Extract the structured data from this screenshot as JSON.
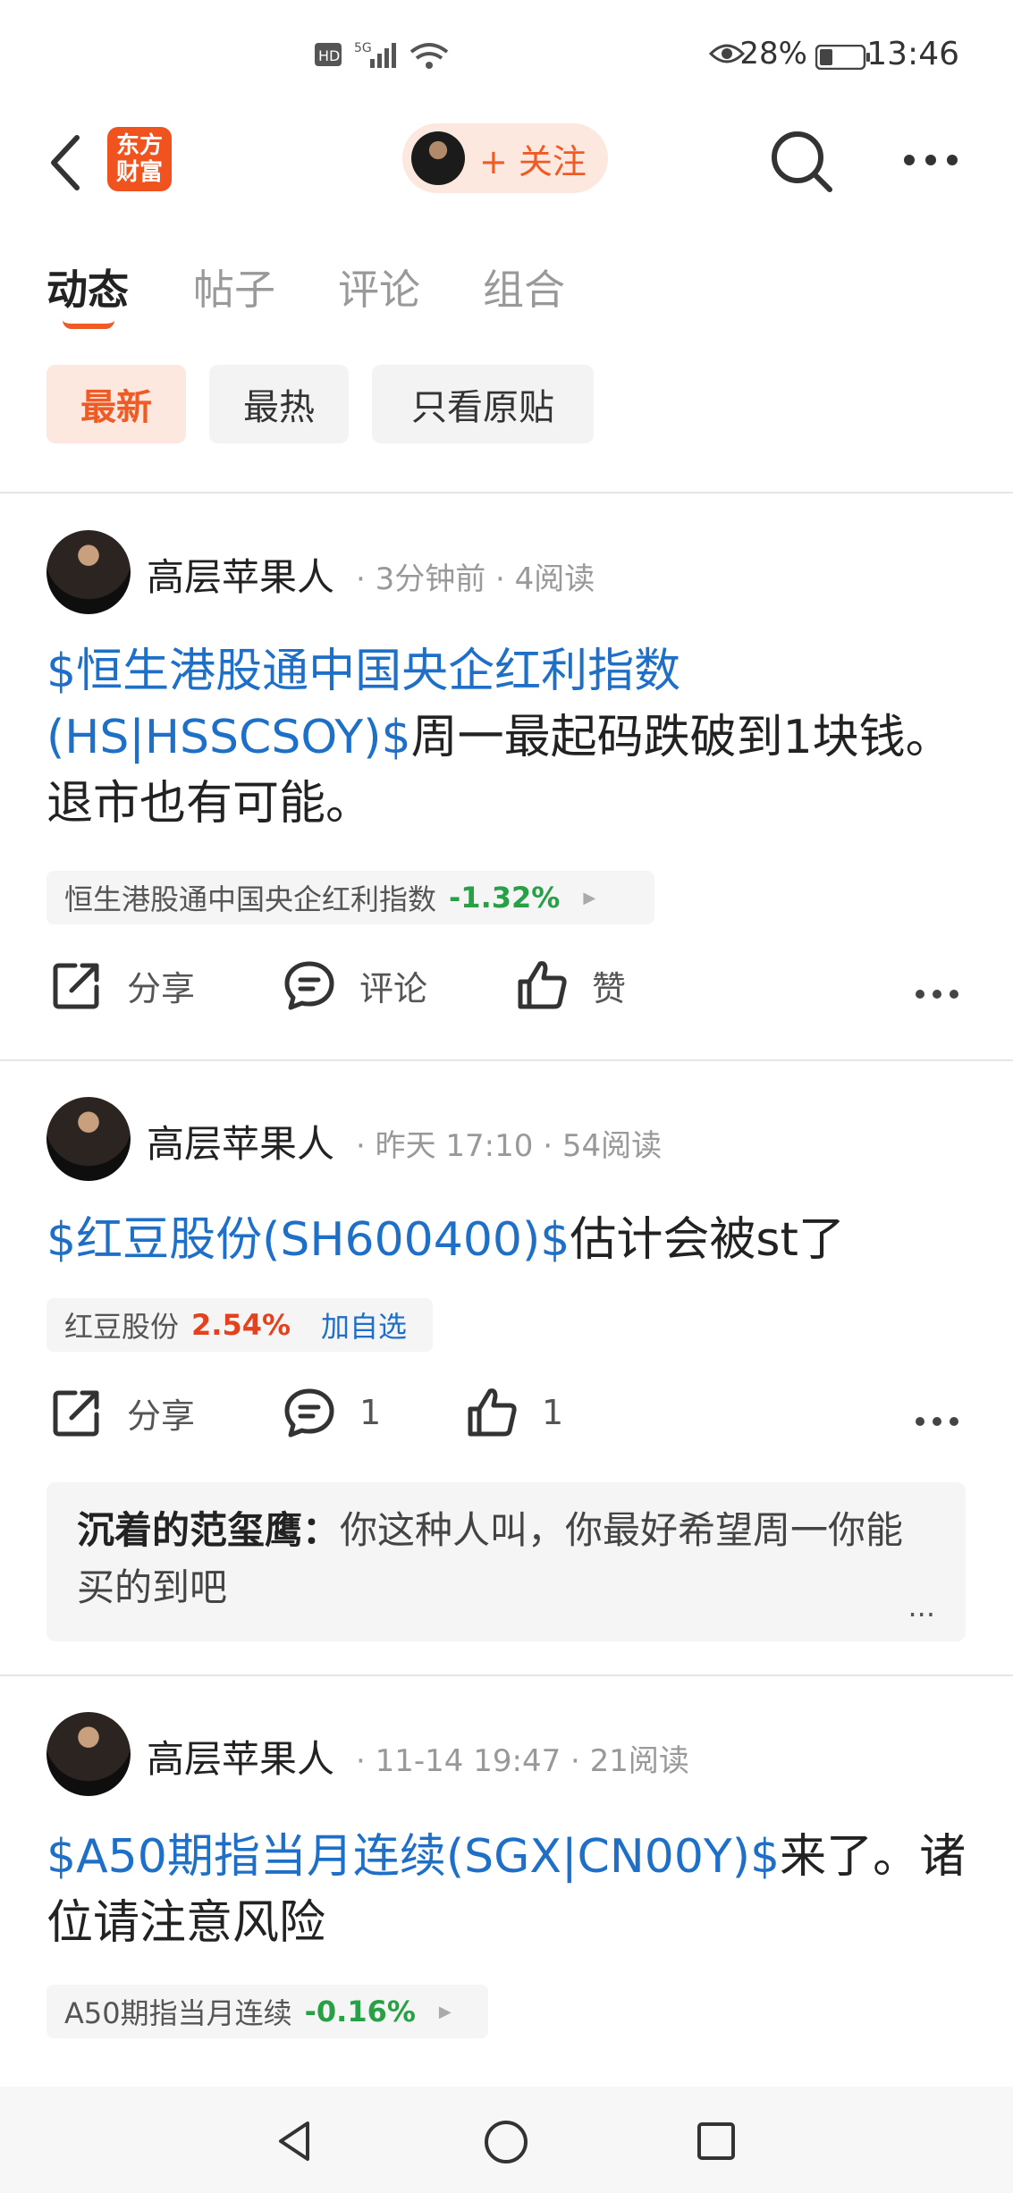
{
  "status_bar": {
    "network": "HD 5G",
    "battery_pct": "28%",
    "time": "13:46"
  },
  "header": {
    "logo_text_line1": "东方",
    "logo_text_line2": "财富",
    "follow_label": "+ 关注"
  },
  "tabs": [
    {
      "label": "动态"
    },
    {
      "label": "帖子"
    },
    {
      "label": "评论"
    },
    {
      "label": "组合"
    }
  ],
  "filters": [
    {
      "label": "最新"
    },
    {
      "label": "最热"
    },
    {
      "label": "只看原贴"
    }
  ],
  "posts": [
    {
      "user": "高层苹果人",
      "meta": "· 3分钟前 · 4阅读",
      "link_text": "$恒生港股通中国央企红利指数(HS|HSSCSOY)$",
      "body_text": "周一最起码跌破到1块钱。退市也有可能。",
      "stock_name": "恒生港股通中国央企红利指数",
      "stock_change": "-1.32%",
      "share_label": "分享",
      "comment_label": "评论",
      "like_label": "赞"
    },
    {
      "user": "高层苹果人",
      "meta": "· 昨天 17:10 · 54阅读",
      "link_text": "$红豆股份(SH600400)$",
      "body_text": "估计会被st了",
      "stock_name": "红豆股份",
      "stock_change": "2.54%",
      "stock_action": "加自选",
      "share_label": "分享",
      "comment_label": "1",
      "like_label": "1",
      "reply_user": "沉着的范玺鹰：",
      "reply_text": "你这种人叫，你最好希望周一你能买的到吧",
      "reply_more": "..."
    },
    {
      "user": "高层苹果人",
      "meta": "· 11-14 19:47 · 21阅读",
      "link_text": "$A50期指当月连续(SGX|CN00Y)$",
      "body_text": "来了。诸位请注意风险",
      "stock_name": "A50期指当月连续",
      "stock_change": "-0.16%"
    }
  ],
  "colors": {
    "accent": "#f05a24",
    "link": "#1e6fc8",
    "down": "#27a046",
    "up": "#e5411c"
  }
}
